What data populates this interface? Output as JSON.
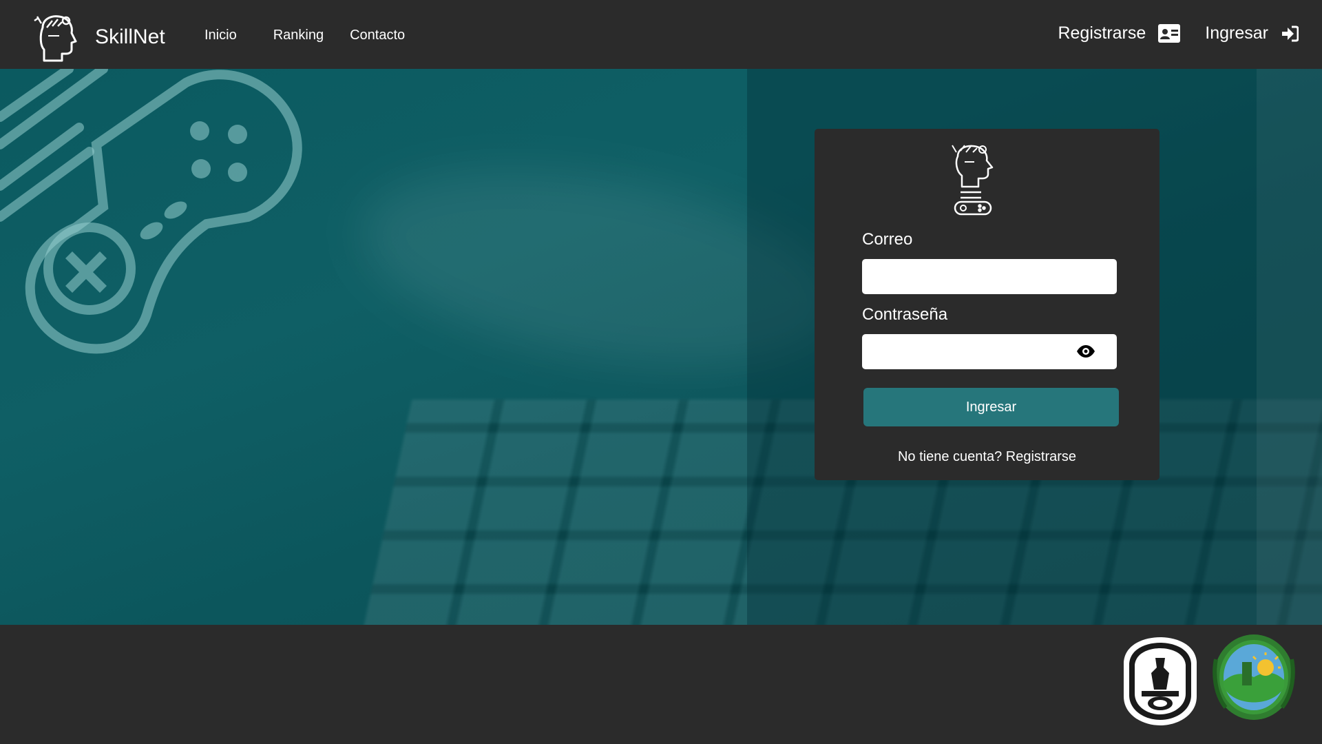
{
  "navbar": {
    "brand": "SkillNet",
    "links": [
      "Inicio",
      "Ranking",
      "Contacto"
    ],
    "register_label": "Registrarse",
    "login_label": "Ingresar"
  },
  "login": {
    "email_label": "Correo",
    "email_value": "",
    "password_label": "Contraseña",
    "password_value": "",
    "submit_label": "Ingresar",
    "no_account_text": "No tiene cuenta?",
    "register_link": "Registrarse"
  },
  "colors": {
    "navbar": "#2b2b2b",
    "hero": "#0f5f65",
    "button": "#26767b",
    "footer": "#2b2b2b"
  },
  "icons": {
    "brand": "head-idea-icon",
    "register": "id-card-icon",
    "login": "sign-in-icon",
    "password_toggle": "eye-icon",
    "card_logo": "head-gamepad-icon",
    "hero_decoration": "gamepad-icon"
  },
  "footer": {
    "logos": [
      "university-seal",
      "provincial-seal"
    ]
  }
}
